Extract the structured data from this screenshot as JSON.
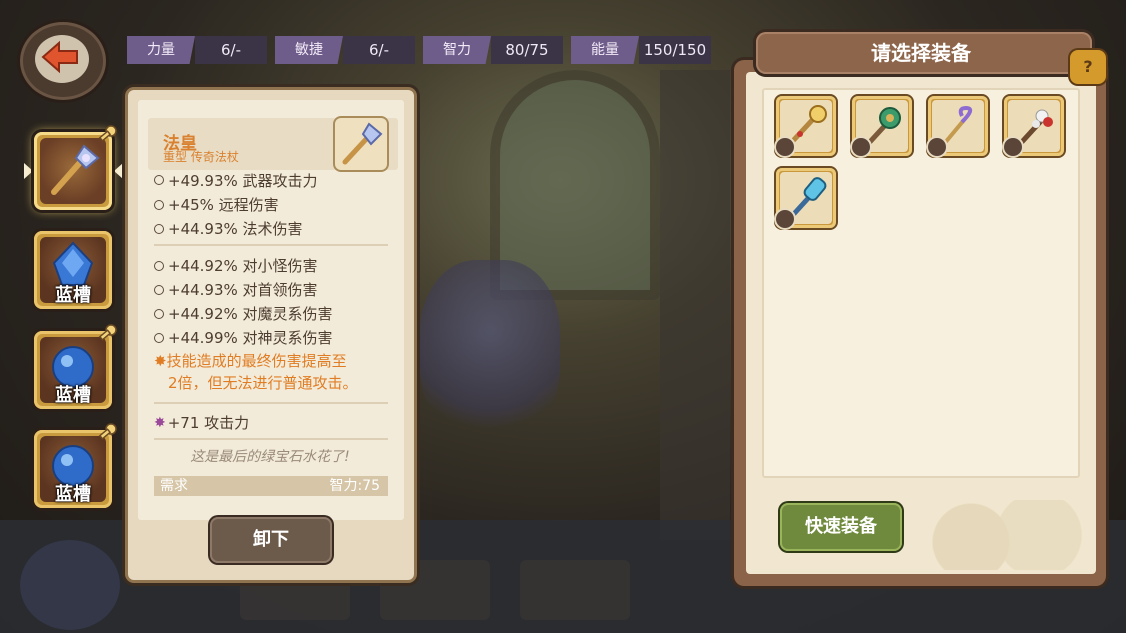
{
  "stats": [
    {
      "label": "力量",
      "value": "6/-"
    },
    {
      "label": "敏捷",
      "value": "6/-"
    },
    {
      "label": "智力",
      "value": "80/75"
    },
    {
      "label": "能量",
      "value": "150/150"
    }
  ],
  "slots": [
    {
      "label": "",
      "icon": "staff-icon",
      "active": true
    },
    {
      "label": "蓝槽",
      "icon": "blue-gem-icon"
    },
    {
      "label": "蓝槽",
      "icon": "blue-orb-icon"
    },
    {
      "label": "蓝槽",
      "icon": "blue-orb-icon"
    }
  ],
  "detail": {
    "name": "法皇",
    "type": "重型 传奇法杖",
    "attrs_top": [
      "+49.93% 武器攻击力",
      "+45% 远程伤害",
      "+44.93% 法术伤害"
    ],
    "attrs_mid": [
      "+44.92% 对小怪伤害",
      "+44.93% 对首领伤害",
      "+44.92% 对魔灵系伤害",
      "+44.99% 对神灵系伤害"
    ],
    "special_line1": "技能造成的最终伤害提高至",
    "special_line2": "2倍，但无法进行普通攻击。",
    "attack": "+71 攻击力",
    "flavor": "这是最后的绿宝石水花了!",
    "req_label": "需求",
    "req_value": "智力:75",
    "unequip_label": "卸下"
  },
  "select_panel": {
    "title": "请选择装备",
    "help_label": "?",
    "quick_equip_label": "快速装备",
    "items": [
      "staff-golden-icon",
      "staff-emerald-icon",
      "staff-hook-icon",
      "staff-flower-icon",
      "staff-crystal-icon"
    ]
  },
  "colors": {
    "accent_orange": "#d9812e",
    "stat_label_bg": "#6e5d8a",
    "quick_btn_green": "#6f8a3c",
    "slot_gold": "#c99b3e"
  }
}
